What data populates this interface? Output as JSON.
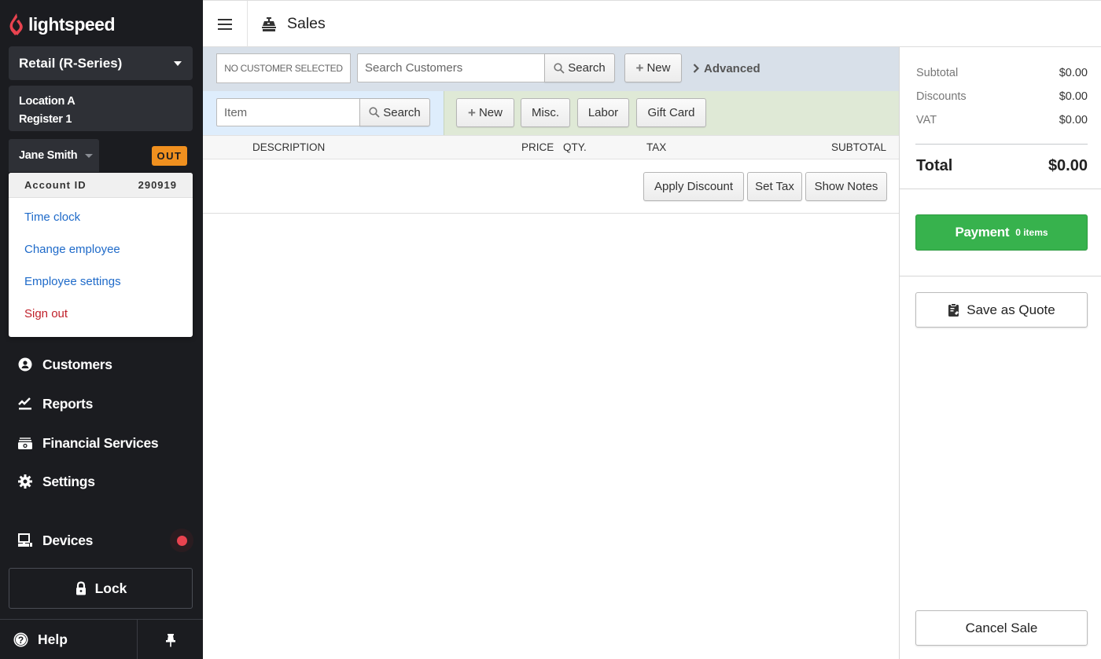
{
  "brand": {
    "name": "lightspeed",
    "accent": "#e8434f"
  },
  "sidebar": {
    "store_select": "Retail (R-Series)",
    "location": "Location A",
    "register": "Register 1",
    "user": "Jane Smith",
    "clock_status": "OUT",
    "account_menu": {
      "account_label": "Account ID",
      "account_id": "290919",
      "items": [
        {
          "label": "Time clock"
        },
        {
          "label": "Change employee"
        },
        {
          "label": "Employee settings"
        },
        {
          "label": "Sign out"
        }
      ]
    },
    "nav": [
      {
        "label": "Customers",
        "icon": "customer-icon"
      },
      {
        "label": "Reports",
        "icon": "reports-icon"
      },
      {
        "label": "Financial Services",
        "icon": "money-icon"
      },
      {
        "label": "Settings",
        "icon": "gear-icon"
      },
      {
        "label": "Devices",
        "icon": "devices-icon",
        "status_color": "#e8434f"
      }
    ],
    "lock_label": "Lock",
    "help_label": "Help"
  },
  "header": {
    "title": "Sales"
  },
  "customer_bar": {
    "no_customer": "NO CUSTOMER SELECTED",
    "search_placeholder": "Search Customers",
    "search_label": "Search",
    "new_label": "New",
    "advanced_label": "Advanced"
  },
  "item_bar": {
    "item_placeholder": "Item",
    "search_label": "Search",
    "new_label": "New",
    "misc_label": "Misc.",
    "labor_label": "Labor",
    "gift_card_label": "Gift Card"
  },
  "table": {
    "columns": [
      "DESCRIPTION",
      "PRICE",
      "QTY.",
      "TAX",
      "SUBTOTAL"
    ],
    "rows": [],
    "actions": [
      "Apply Discount",
      "Set Tax",
      "Show Notes"
    ]
  },
  "summary": {
    "subtotal_label": "Subtotal",
    "subtotal": "$0.00",
    "discounts_label": "Discounts",
    "discounts": "$0.00",
    "vat_label": "VAT",
    "vat": "$0.00",
    "total_label": "Total",
    "total": "$0.00",
    "payment_label": "Payment",
    "payment_count": "0 items",
    "quote_label": "Save as Quote",
    "cancel_label": "Cancel Sale"
  }
}
